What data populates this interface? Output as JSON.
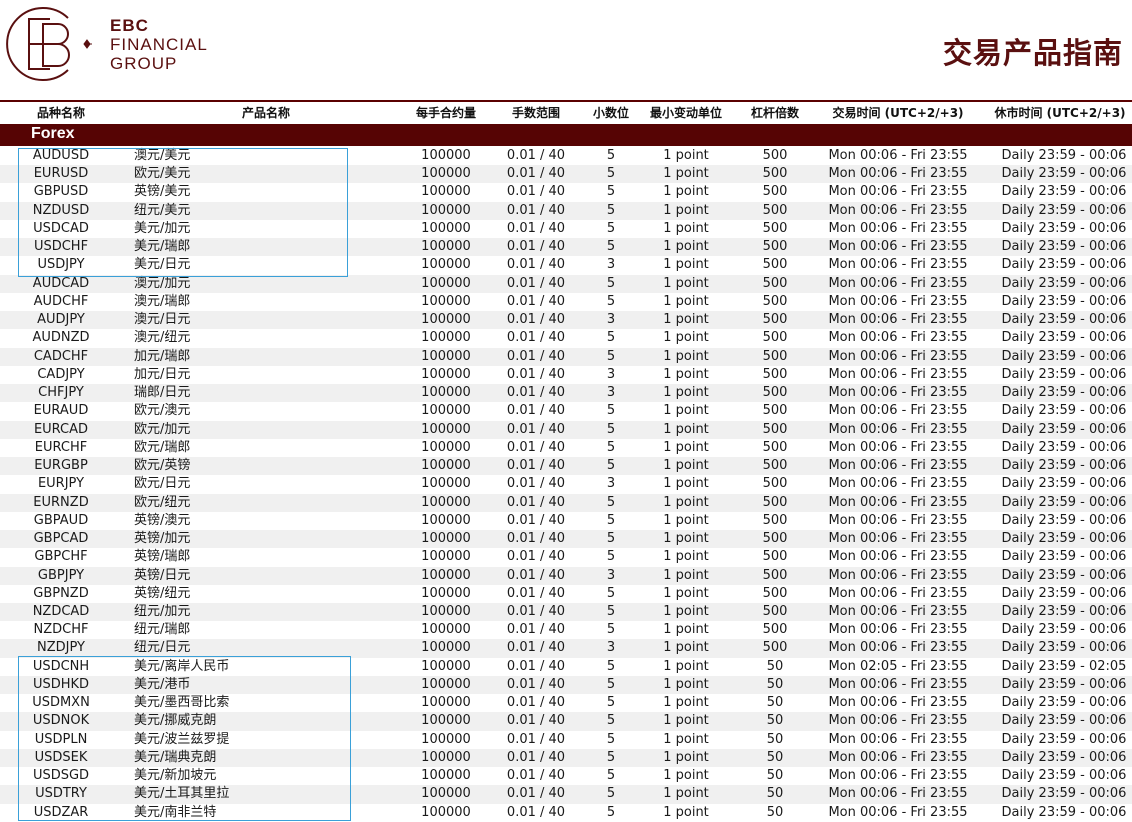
{
  "header": {
    "brand_line1": "EBC",
    "brand_line2": "FINANCIAL",
    "brand_line3": "GROUP",
    "logo_letters": "EBC",
    "doc_title": "交易产品指南"
  },
  "columns": {
    "symbol": "品种名称",
    "name": "产品名称",
    "contract_size": "每手合约量",
    "lot_range": "手数范围",
    "digits": "小数位",
    "min_tick": "最小变动单位",
    "leverage": "杠杆倍数",
    "trading_hours": "交易时间 (UTC+2/+3)",
    "close_hours": "休市时间 (UTC+2/+3)"
  },
  "section": {
    "title": "Forex"
  },
  "colors": {
    "brand": "#560404",
    "highlight_border": "#3aa0d8",
    "row_alt": "#f0f0f0"
  },
  "rows": [
    {
      "symbol": "AUDUSD",
      "name": "澳元/美元",
      "contract_size": "100000",
      "lot_range": "0.01 / 40",
      "digits": "5",
      "min_tick": "1 point",
      "leverage": "500",
      "trading_hours": "Mon 00:06 - Fri 23:55",
      "close_hours": "Daily 23:59 - 00:06"
    },
    {
      "symbol": "EURUSD",
      "name": "欧元/美元",
      "contract_size": "100000",
      "lot_range": "0.01 / 40",
      "digits": "5",
      "min_tick": "1 point",
      "leverage": "500",
      "trading_hours": "Mon 00:06 - Fri 23:55",
      "close_hours": "Daily 23:59 - 00:06"
    },
    {
      "symbol": "GBPUSD",
      "name": "英镑/美元",
      "contract_size": "100000",
      "lot_range": "0.01 / 40",
      "digits": "5",
      "min_tick": "1 point",
      "leverage": "500",
      "trading_hours": "Mon 00:06 - Fri 23:55",
      "close_hours": "Daily 23:59 - 00:06"
    },
    {
      "symbol": "NZDUSD",
      "name": "纽元/美元",
      "contract_size": "100000",
      "lot_range": "0.01 / 40",
      "digits": "5",
      "min_tick": "1 point",
      "leverage": "500",
      "trading_hours": "Mon 00:06 - Fri 23:55",
      "close_hours": "Daily 23:59 - 00:06"
    },
    {
      "symbol": "USDCAD",
      "name": "美元/加元",
      "contract_size": "100000",
      "lot_range": "0.01 / 40",
      "digits": "5",
      "min_tick": "1 point",
      "leverage": "500",
      "trading_hours": "Mon 00:06 - Fri 23:55",
      "close_hours": "Daily 23:59 - 00:06"
    },
    {
      "symbol": "USDCHF",
      "name": "美元/瑞郎",
      "contract_size": "100000",
      "lot_range": "0.01 / 40",
      "digits": "5",
      "min_tick": "1 point",
      "leverage": "500",
      "trading_hours": "Mon 00:06 - Fri 23:55",
      "close_hours": "Daily 23:59 - 00:06"
    },
    {
      "symbol": "USDJPY",
      "name": "美元/日元",
      "contract_size": "100000",
      "lot_range": "0.01 / 40",
      "digits": "3",
      "min_tick": "1 point",
      "leverage": "500",
      "trading_hours": "Mon 00:06 - Fri 23:55",
      "close_hours": "Daily 23:59 - 00:06"
    },
    {
      "symbol": "AUDCAD",
      "name": "澳元/加元",
      "contract_size": "100000",
      "lot_range": "0.01 / 40",
      "digits": "5",
      "min_tick": "1 point",
      "leverage": "500",
      "trading_hours": "Mon 00:06 - Fri 23:55",
      "close_hours": "Daily 23:59 - 00:06"
    },
    {
      "symbol": "AUDCHF",
      "name": "澳元/瑞郎",
      "contract_size": "100000",
      "lot_range": "0.01 / 40",
      "digits": "5",
      "min_tick": "1 point",
      "leverage": "500",
      "trading_hours": "Mon 00:06 - Fri 23:55",
      "close_hours": "Daily 23:59 - 00:06"
    },
    {
      "symbol": "AUDJPY",
      "name": "澳元/日元",
      "contract_size": "100000",
      "lot_range": "0.01 / 40",
      "digits": "3",
      "min_tick": "1 point",
      "leverage": "500",
      "trading_hours": "Mon 00:06 - Fri 23:55",
      "close_hours": "Daily 23:59 - 00:06"
    },
    {
      "symbol": "AUDNZD",
      "name": "澳元/纽元",
      "contract_size": "100000",
      "lot_range": "0.01 / 40",
      "digits": "5",
      "min_tick": "1 point",
      "leverage": "500",
      "trading_hours": "Mon 00:06 - Fri 23:55",
      "close_hours": "Daily 23:59 - 00:06"
    },
    {
      "symbol": "CADCHF",
      "name": "加元/瑞郎",
      "contract_size": "100000",
      "lot_range": "0.01 / 40",
      "digits": "5",
      "min_tick": "1 point",
      "leverage": "500",
      "trading_hours": "Mon 00:06 - Fri 23:55",
      "close_hours": "Daily 23:59 - 00:06"
    },
    {
      "symbol": "CADJPY",
      "name": "加元/日元",
      "contract_size": "100000",
      "lot_range": "0.01 / 40",
      "digits": "3",
      "min_tick": "1 point",
      "leverage": "500",
      "trading_hours": "Mon 00:06 - Fri 23:55",
      "close_hours": "Daily 23:59 - 00:06"
    },
    {
      "symbol": "CHFJPY",
      "name": "瑞郎/日元",
      "contract_size": "100000",
      "lot_range": "0.01 / 40",
      "digits": "3",
      "min_tick": "1 point",
      "leverage": "500",
      "trading_hours": "Mon 00:06 - Fri 23:55",
      "close_hours": "Daily 23:59 - 00:06"
    },
    {
      "symbol": "EURAUD",
      "name": "欧元/澳元",
      "contract_size": "100000",
      "lot_range": "0.01 / 40",
      "digits": "5",
      "min_tick": "1 point",
      "leverage": "500",
      "trading_hours": "Mon 00:06 - Fri 23:55",
      "close_hours": "Daily 23:59 - 00:06"
    },
    {
      "symbol": "EURCAD",
      "name": "欧元/加元",
      "contract_size": "100000",
      "lot_range": "0.01 / 40",
      "digits": "5",
      "min_tick": "1 point",
      "leverage": "500",
      "trading_hours": "Mon 00:06 - Fri 23:55",
      "close_hours": "Daily 23:59 - 00:06"
    },
    {
      "symbol": "EURCHF",
      "name": "欧元/瑞郎",
      "contract_size": "100000",
      "lot_range": "0.01 / 40",
      "digits": "5",
      "min_tick": "1 point",
      "leverage": "500",
      "trading_hours": "Mon 00:06 - Fri 23:55",
      "close_hours": "Daily 23:59 - 00:06"
    },
    {
      "symbol": "EURGBP",
      "name": "欧元/英镑",
      "contract_size": "100000",
      "lot_range": "0.01 / 40",
      "digits": "5",
      "min_tick": "1 point",
      "leverage": "500",
      "trading_hours": "Mon 00:06 - Fri 23:55",
      "close_hours": "Daily 23:59 - 00:06"
    },
    {
      "symbol": "EURJPY",
      "name": "欧元/日元",
      "contract_size": "100000",
      "lot_range": "0.01 / 40",
      "digits": "3",
      "min_tick": "1 point",
      "leverage": "500",
      "trading_hours": "Mon 00:06 - Fri 23:55",
      "close_hours": "Daily 23:59 - 00:06"
    },
    {
      "symbol": "EURNZD",
      "name": "欧元/纽元",
      "contract_size": "100000",
      "lot_range": "0.01 / 40",
      "digits": "5",
      "min_tick": "1 point",
      "leverage": "500",
      "trading_hours": "Mon 00:06 - Fri 23:55",
      "close_hours": "Daily 23:59 - 00:06"
    },
    {
      "symbol": "GBPAUD",
      "name": "英镑/澳元",
      "contract_size": "100000",
      "lot_range": "0.01 / 40",
      "digits": "5",
      "min_tick": "1 point",
      "leverage": "500",
      "trading_hours": "Mon 00:06 - Fri 23:55",
      "close_hours": "Daily 23:59 - 00:06"
    },
    {
      "symbol": "GBPCAD",
      "name": "英镑/加元",
      "contract_size": "100000",
      "lot_range": "0.01 / 40",
      "digits": "5",
      "min_tick": "1 point",
      "leverage": "500",
      "trading_hours": "Mon 00:06 - Fri 23:55",
      "close_hours": "Daily 23:59 - 00:06"
    },
    {
      "symbol": "GBPCHF",
      "name": "英镑/瑞郎",
      "contract_size": "100000",
      "lot_range": "0.01 / 40",
      "digits": "5",
      "min_tick": "1 point",
      "leverage": "500",
      "trading_hours": "Mon 00:06 - Fri 23:55",
      "close_hours": "Daily 23:59 - 00:06"
    },
    {
      "symbol": "GBPJPY",
      "name": "英镑/日元",
      "contract_size": "100000",
      "lot_range": "0.01 / 40",
      "digits": "3",
      "min_tick": "1 point",
      "leverage": "500",
      "trading_hours": "Mon 00:06 - Fri 23:55",
      "close_hours": "Daily 23:59 - 00:06"
    },
    {
      "symbol": "GBPNZD",
      "name": "英镑/纽元",
      "contract_size": "100000",
      "lot_range": "0.01 / 40",
      "digits": "5",
      "min_tick": "1 point",
      "leverage": "500",
      "trading_hours": "Mon 00:06 - Fri 23:55",
      "close_hours": "Daily 23:59 - 00:06"
    },
    {
      "symbol": "NZDCAD",
      "name": "纽元/加元",
      "contract_size": "100000",
      "lot_range": "0.01 / 40",
      "digits": "5",
      "min_tick": "1 point",
      "leverage": "500",
      "trading_hours": "Mon 00:06 - Fri 23:55",
      "close_hours": "Daily 23:59 - 00:06"
    },
    {
      "symbol": "NZDCHF",
      "name": "纽元/瑞郎",
      "contract_size": "100000",
      "lot_range": "0.01 / 40",
      "digits": "5",
      "min_tick": "1 point",
      "leverage": "500",
      "trading_hours": "Mon 00:06 - Fri 23:55",
      "close_hours": "Daily 23:59 - 00:06"
    },
    {
      "symbol": "NZDJPY",
      "name": "纽元/日元",
      "contract_size": "100000",
      "lot_range": "0.01 / 40",
      "digits": "3",
      "min_tick": "1 point",
      "leverage": "500",
      "trading_hours": "Mon 00:06 - Fri 23:55",
      "close_hours": "Daily 23:59 - 00:06"
    },
    {
      "symbol": "USDCNH",
      "name": "美元/离岸人民币",
      "contract_size": "100000",
      "lot_range": "0.01 / 40",
      "digits": "5",
      "min_tick": "1 point",
      "leverage": "50",
      "trading_hours": "Mon 02:05 - Fri 23:55",
      "close_hours": "Daily 23:59 - 02:05"
    },
    {
      "symbol": "USDHKD",
      "name": "美元/港币",
      "contract_size": "100000",
      "lot_range": "0.01 / 40",
      "digits": "5",
      "min_tick": "1 point",
      "leverage": "50",
      "trading_hours": "Mon 00:06 - Fri 23:55",
      "close_hours": "Daily 23:59 - 00:06"
    },
    {
      "symbol": "USDMXN",
      "name": "美元/墨西哥比索",
      "contract_size": "100000",
      "lot_range": "0.01 / 40",
      "digits": "5",
      "min_tick": "1 point",
      "leverage": "50",
      "trading_hours": "Mon 00:06 - Fri 23:55",
      "close_hours": "Daily 23:59 - 00:06"
    },
    {
      "symbol": "USDNOK",
      "name": "美元/挪威克朗",
      "contract_size": "100000",
      "lot_range": "0.01 / 40",
      "digits": "5",
      "min_tick": "1 point",
      "leverage": "50",
      "trading_hours": "Mon 00:06 - Fri 23:55",
      "close_hours": "Daily 23:59 - 00:06"
    },
    {
      "symbol": "USDPLN",
      "name": "美元/波兰兹罗提",
      "contract_size": "100000",
      "lot_range": "0.01 / 40",
      "digits": "5",
      "min_tick": "1 point",
      "leverage": "50",
      "trading_hours": "Mon 00:06 - Fri 23:55",
      "close_hours": "Daily 23:59 - 00:06"
    },
    {
      "symbol": "USDSEK",
      "name": "美元/瑞典克朗",
      "contract_size": "100000",
      "lot_range": "0.01 / 40",
      "digits": "5",
      "min_tick": "1 point",
      "leverage": "50",
      "trading_hours": "Mon 00:06 - Fri 23:55",
      "close_hours": "Daily 23:59 - 00:06"
    },
    {
      "symbol": "USDSGD",
      "name": "美元/新加坡元",
      "contract_size": "100000",
      "lot_range": "0.01 / 40",
      "digits": "5",
      "min_tick": "1 point",
      "leverage": "50",
      "trading_hours": "Mon 00:06 - Fri 23:55",
      "close_hours": "Daily 23:59 - 00:06"
    },
    {
      "symbol": "USDTRY",
      "name": "美元/土耳其里拉",
      "contract_size": "100000",
      "lot_range": "0.01 / 40",
      "digits": "5",
      "min_tick": "1 point",
      "leverage": "50",
      "trading_hours": "Mon 00:06 - Fri 23:55",
      "close_hours": "Daily 23:59 - 00:06"
    },
    {
      "symbol": "USDZAR",
      "name": "美元/南非兰特",
      "contract_size": "100000",
      "lot_range": "0.01 / 40",
      "digits": "5",
      "min_tick": "1 point",
      "leverage": "50",
      "trading_hours": "Mon 00:06 - Fri 23:55",
      "close_hours": "Daily 23:59 - 00:06"
    }
  ]
}
